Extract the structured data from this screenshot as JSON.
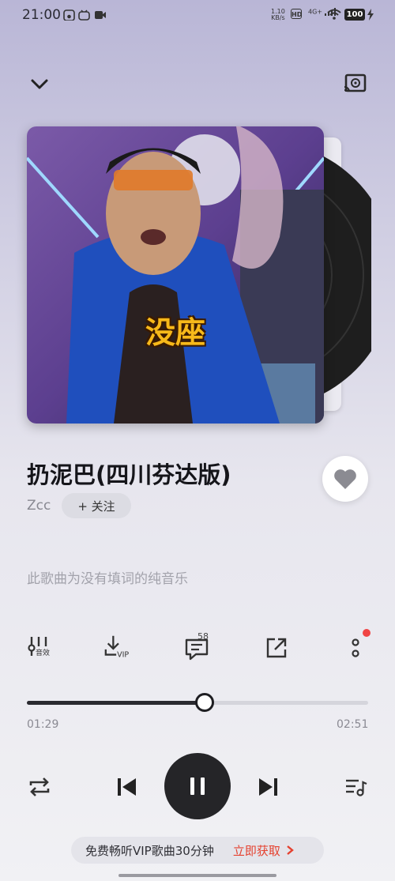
{
  "status_bar": {
    "time": "21:00",
    "net_speed_value": "1.10",
    "net_speed_unit": "KB/s",
    "hd": "HD",
    "signal": "4G+",
    "battery": "100"
  },
  "header": {
    "collapse_icon": "chevron-down-icon",
    "cast_icon": "cast-music-icon"
  },
  "album": {
    "cover_caption": "没座"
  },
  "song": {
    "title": "扔泥巴(四川芬达版)",
    "artist": "Zcc",
    "follow_label": "+ 关注",
    "liked": true
  },
  "lyrics_note": "此歌曲为没有填词的纯音乐",
  "actions": {
    "sound_effect_label": "音效",
    "download_label": "VIP",
    "comment_count": "58",
    "share_icon": "share-icon",
    "more_icon": "more-dots-icon"
  },
  "progress": {
    "current": "01:29",
    "duration": "02:51",
    "fraction": 0.52
  },
  "controls": {
    "repeat_icon": "repeat-icon",
    "prev_icon": "previous-icon",
    "play_state": "playing",
    "next_icon": "next-icon",
    "playlist_icon": "playlist-icon"
  },
  "vip_banner": {
    "text": "免费畅听VIP歌曲30分钟",
    "cta": "立即获取"
  },
  "colors": {
    "accent_red": "#e5412f",
    "dark": "#252528"
  }
}
